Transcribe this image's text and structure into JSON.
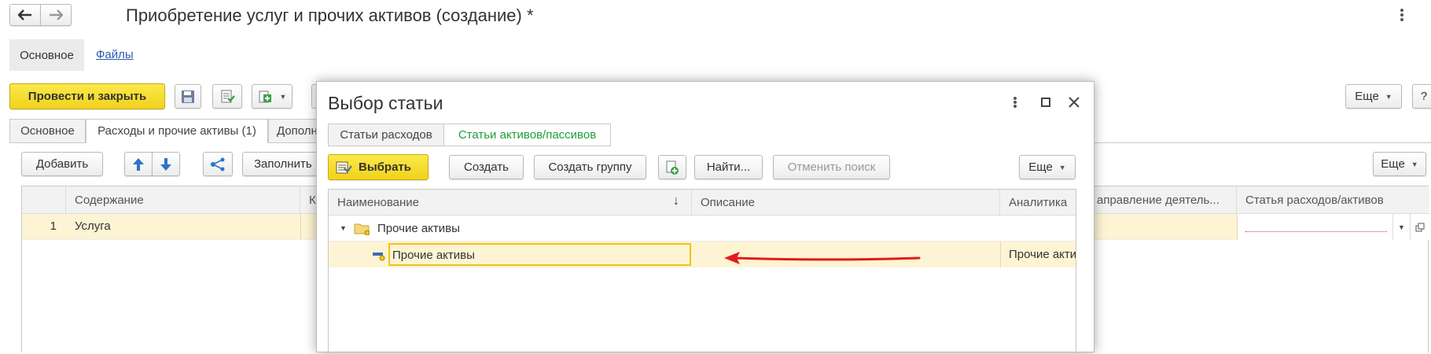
{
  "window": {
    "title": "Приобретение услуг и прочих активов (создание) *",
    "nav_tabs": [
      "Основное",
      "Файлы"
    ]
  },
  "toolbar": {
    "post_close": "Провести и закрыть",
    "more": "Еще",
    "help": "?"
  },
  "doc_tabs": [
    "Основное",
    "Расходы и прочие активы (1)",
    "Дополн"
  ],
  "table_toolbar": {
    "add": "Добавить",
    "fill": "Заполнить",
    "more": "Еще"
  },
  "table": {
    "columns": [
      "Содержание",
      "К",
      "аправление деятель...",
      "Статья расходов/активов"
    ],
    "rows": [
      {
        "num": "1",
        "content": "Услуга"
      }
    ]
  },
  "dialog": {
    "title": "Выбор статьи",
    "tabs": [
      "Статьи расходов",
      "Статьи активов/пассивов"
    ],
    "buttons": {
      "select": "Выбрать",
      "create": "Создать",
      "create_group": "Создать группу",
      "find": "Найти...",
      "cancel_search": "Отменить поиск",
      "more": "Еще"
    },
    "columns": [
      "Наименование",
      "Описание",
      "Аналитика"
    ],
    "sort_indicator": "↓",
    "rows": [
      {
        "name": "Прочие активы",
        "description": "",
        "analytics": "",
        "type": "group"
      },
      {
        "name": "Прочие активы",
        "description": "",
        "analytics": "Прочие акти",
        "type": "item"
      }
    ]
  },
  "colors": {
    "accent_yellow": "#f3d526",
    "selected_row": "#fdf4d3",
    "active_tab_text": "#1e9e3b",
    "link": "#2a5db0",
    "arrow": "#e01b1b"
  }
}
